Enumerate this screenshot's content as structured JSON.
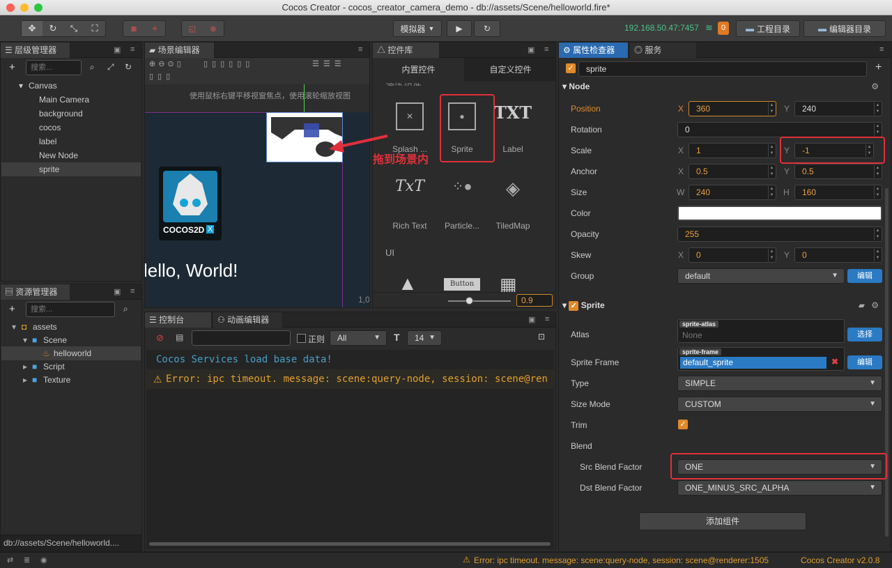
{
  "window": {
    "title": "Cocos Creator - cocos_creator_camera_demo - db://assets/Scene/helloworld.fire*"
  },
  "toolbar": {
    "simulator_label": "模拟器",
    "ip_address": "192.168.50.47:7457",
    "notification_count": "0",
    "project_dir_label": "工程目录",
    "editor_dir_label": "编辑器目录"
  },
  "hierarchy": {
    "tab_label": "层级管理器",
    "search_placeholder": "搜索...",
    "items": [
      "Canvas",
      "Main Camera",
      "background",
      "cocos",
      "label",
      "New Node",
      "sprite"
    ]
  },
  "assets": {
    "tab_label": "资源管理器",
    "search_placeholder": "搜索...",
    "items": [
      "assets",
      "Scene",
      "helloworld",
      "Script",
      "Texture"
    ],
    "status_path": "db://assets/Scene/helloworld...."
  },
  "scene": {
    "tab_label": "场景编辑器",
    "hint": "使用鼠标右键平移视窗焦点，使用滚轮缩放视图",
    "hello_text": "lello, World!",
    "coord_label": "1,0",
    "logo_text": "COCOS2D",
    "logo_badge": "X"
  },
  "widgets": {
    "tab_label": "控件库",
    "tab_builtin": "内置控件",
    "tab_custom": "自定义控件",
    "section_cut": "渲染组件",
    "items": [
      "Splash ...",
      "Sprite",
      "Label",
      "Rich Text",
      "Particle...",
      "TiledMap"
    ],
    "label_glyph": "TXT",
    "richtext_glyph": "TxT",
    "ui_section": "UI",
    "button_glyph": "Button",
    "zoom_value": "0.9",
    "annotation": "拖到场景内"
  },
  "console": {
    "tab_label": "控制台",
    "anim_tab_label": "动画编辑器",
    "regex_label": "正则",
    "filter_value": "All",
    "font_size": "14",
    "log_info": "Cocos Services load base data!",
    "log_error": "Error: ipc timeout. message: scene:query-node, session: scene@ren"
  },
  "inspector": {
    "tab_label": "属性检查器",
    "service_tab": "服务",
    "node_name": "sprite",
    "node_section": "Node",
    "position": {
      "label": "Position",
      "x": "360",
      "y": "240"
    },
    "rotation": {
      "label": "Rotation",
      "value": "0"
    },
    "scale": {
      "label": "Scale",
      "x": "1",
      "y": "-1"
    },
    "anchor": {
      "label": "Anchor",
      "x": "0.5",
      "y": "0.5"
    },
    "size": {
      "label": "Size",
      "w": "240",
      "h": "160"
    },
    "color": {
      "label": "Color",
      "value": "#ffffff"
    },
    "opacity": {
      "label": "Opacity",
      "value": "255"
    },
    "skew": {
      "label": "Skew",
      "x": "0",
      "y": "0"
    },
    "group": {
      "label": "Group",
      "value": "default",
      "edit": "编辑"
    },
    "sprite_section": "Sprite",
    "atlas": {
      "label": "Atlas",
      "tag": "sprite-atlas",
      "value": "None",
      "button": "选择"
    },
    "sprite_frame": {
      "label": "Sprite Frame",
      "tag": "sprite-frame",
      "value": "default_sprite",
      "button": "编辑"
    },
    "type": {
      "label": "Type",
      "value": "SIMPLE"
    },
    "size_mode": {
      "label": "Size Mode",
      "value": "CUSTOM"
    },
    "trim": {
      "label": "Trim",
      "checked": true
    },
    "blend": {
      "label": "Blend"
    },
    "src_blend": {
      "label": "Src Blend Factor",
      "value": "ONE"
    },
    "dst_blend": {
      "label": "Dst Blend Factor",
      "value": "ONE_MINUS_SRC_ALPHA"
    },
    "add_component": "添加组件",
    "axis_x": "X",
    "axis_y": "Y",
    "axis_w": "W",
    "axis_h": "H"
  },
  "statusbar": {
    "error": "Error: ipc timeout. message: scene:query-node, session: scene@renderer:1505",
    "version": "Cocos Creator v2.0.8"
  },
  "colors": {
    "accent": "#2a7ac4",
    "highlight": "#e0303a",
    "orange": "#e8a040"
  }
}
